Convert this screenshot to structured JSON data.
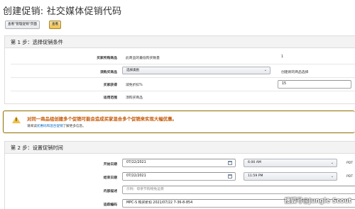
{
  "header": {
    "title": "创建促销: 社交媒体促销代码",
    "view_button": "查看\"管理促销\"页面",
    "query_button": "查看"
  },
  "step1": {
    "heading": "第 1 步：选择促销条件",
    "rows": [
      {
        "label": "买家所购商品",
        "value": "此商品的最低购买数量",
        "extra": "1"
      },
      {
        "label": "须购买商品",
        "value": "选择类别",
        "extra": "创建新的商品选择"
      },
      {
        "label": "买家获得",
        "value": "减免折扣%",
        "extra": "15"
      },
      {
        "label": "适用范围",
        "value": "须购买商品"
      }
    ]
  },
  "alert": {
    "title": "对同一商品组创建多个促销可能会造成买家混合多个促销来实现大幅优惠。",
    "body_prefix": "请阅读",
    "body_link": "优惠码和混合促销",
    "body_suffix": "了解更多信息。"
  },
  "step2": {
    "heading": "第 2 步：设置促销时间",
    "rows": [
      {
        "label": "开始日期",
        "date": "07/22/2021",
        "time": "6:00 AM",
        "tz": "PDT"
      },
      {
        "label": "结束日期",
        "date": "07/22/2021",
        "time": "11:59 PM",
        "tz": "PDT"
      },
      {
        "label": "内部描述",
        "placeholder": "示例：母亲节购物免运费"
      },
      {
        "label": "追踪编码",
        "value": "MPC-S 购买折扣 2021/07/22 7-36-8-854"
      }
    ]
  },
  "watermark": "搜狐号@Jungle Scout",
  "colors": {
    "accent_button": "#f0c14b",
    "alert_title": "#c45500",
    "link": "#0066c0"
  }
}
